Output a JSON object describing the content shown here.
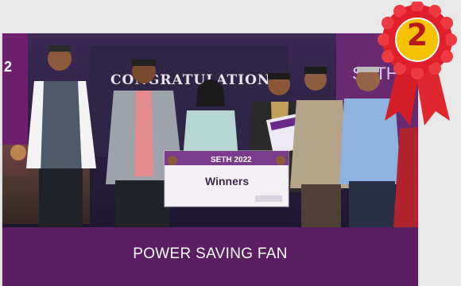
{
  "award": {
    "rank": "2",
    "ribbon_color": "#e01f2a",
    "center_color": "#f2c100"
  },
  "photo": {
    "backdrop_text": "CONGRATULATIONS",
    "banner_left": "2",
    "banner_right": "SETH",
    "cheque_event": "SETH 2022",
    "cheque_label": "Winners"
  },
  "caption": {
    "text": "POWER SAVING FAN"
  },
  "colors": {
    "caption_bg": "#5a1d62",
    "page_bg": "#e9e9ea"
  }
}
